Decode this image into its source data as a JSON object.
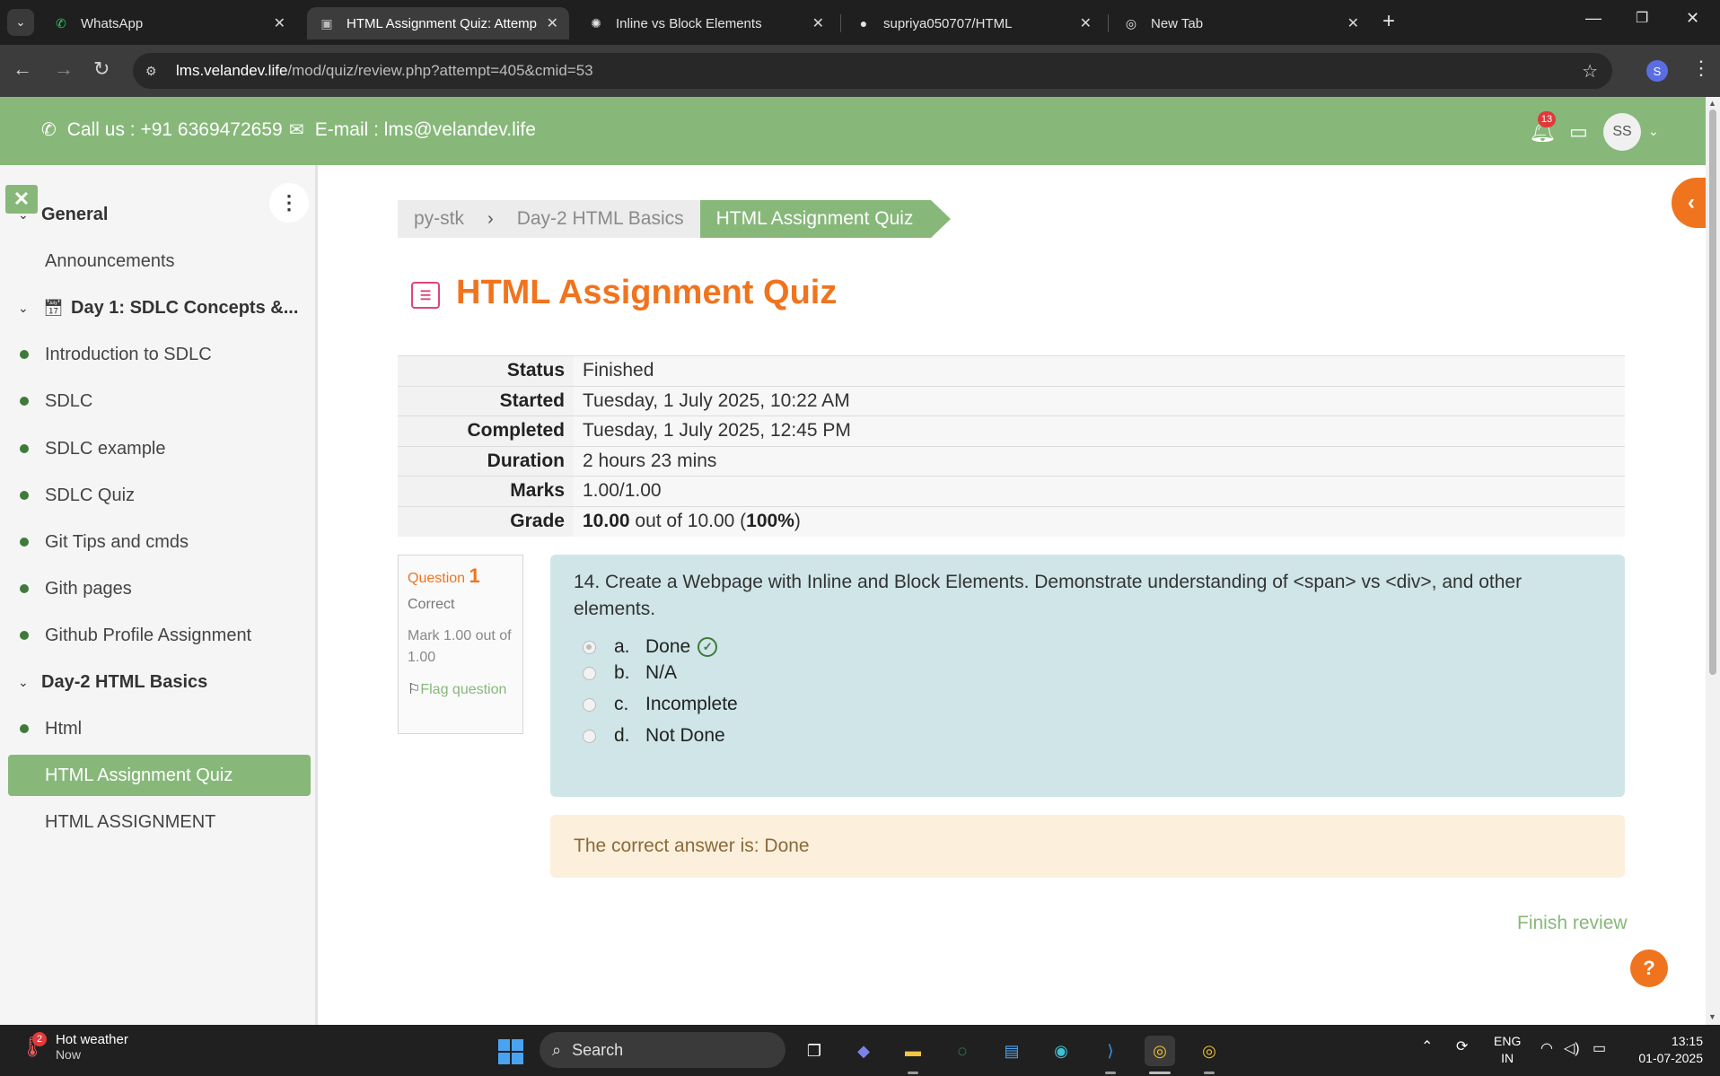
{
  "browser": {
    "tabs": [
      {
        "title": "WhatsApp",
        "icon": "whatsapp-icon",
        "active": false
      },
      {
        "title": "HTML Assignment Quiz: Attemp",
        "icon": "moodle-icon",
        "active": true
      },
      {
        "title": "Inline vs Block Elements",
        "icon": "openai-icon",
        "active": false
      },
      {
        "title": "supriya050707/HTML",
        "icon": "github-icon",
        "active": false
      },
      {
        "title": "New Tab",
        "icon": "chrome-icon",
        "active": false
      }
    ],
    "url_host": "lms.velandev.life",
    "url_path": "/mod/quiz/review.php?attempt=405&cmid=53",
    "profile_initial": "S"
  },
  "header": {
    "call": "Call us : +91 6369472659",
    "email": "E-mail : lms@velandev.life",
    "notifications": "13",
    "avatar": "SS"
  },
  "drawer": {
    "items": [
      {
        "label": "General",
        "type": "section"
      },
      {
        "label": "Announcements",
        "type": "plain"
      },
      {
        "label": "Day 1: SDLC Concepts &...",
        "type": "section-cal"
      },
      {
        "label": "Introduction to SDLC",
        "type": "bullet"
      },
      {
        "label": "SDLC",
        "type": "bullet"
      },
      {
        "label": "SDLC example",
        "type": "bullet"
      },
      {
        "label": "SDLC Quiz",
        "type": "bullet"
      },
      {
        "label": "Git Tips and cmds",
        "type": "bullet"
      },
      {
        "label": "Gith pages",
        "type": "bullet"
      },
      {
        "label": "Github Profile Assignment",
        "type": "bullet"
      },
      {
        "label": "Day-2 HTML Basics",
        "type": "section"
      },
      {
        "label": "Html",
        "type": "bullet"
      },
      {
        "label": "HTML Assignment Quiz",
        "type": "active"
      },
      {
        "label": "HTML ASSIGNMENT",
        "type": "plain"
      }
    ]
  },
  "breadcrumb": [
    "py-stk",
    "Day-2 HTML Basics",
    "HTML Assignment Quiz"
  ],
  "page_title": "HTML Assignment Quiz",
  "summary": {
    "status_label": "Status",
    "status": "Finished",
    "started_label": "Started",
    "started": "Tuesday, 1 July 2025, 10:22 AM",
    "completed_label": "Completed",
    "completed": "Tuesday, 1 July 2025, 12:45 PM",
    "duration_label": "Duration",
    "duration": "2 hours 23 mins",
    "marks_label": "Marks",
    "marks": "1.00/1.00",
    "grade_label": "Grade",
    "grade_value": "10.00",
    "grade_mid": " out of 10.00 (",
    "grade_pct": "100%",
    "grade_end": ")"
  },
  "question": {
    "label": "Question",
    "number": "1",
    "state": "Correct",
    "grade": "Mark 1.00 out of 1.00",
    "flag": "Flag question",
    "text": "14. Create a Webpage with Inline and Block Elements. Demonstrate understanding of <span> vs <div>, and other elements.",
    "answers": [
      {
        "letter": "a.",
        "text": "Done",
        "selected": true,
        "correct": true
      },
      {
        "letter": "b.",
        "text": "N/A",
        "selected": false,
        "correct": false
      },
      {
        "letter": "c.",
        "text": "Incomplete",
        "selected": false,
        "correct": false
      },
      {
        "letter": "d.",
        "text": "Not Done",
        "selected": false,
        "correct": false
      }
    ],
    "feedback": "The correct answer is: Done"
  },
  "finish_review": "Finish review",
  "help": "?",
  "taskbar": {
    "weather_title": "Hot weather",
    "weather_sub": "Now",
    "weather_badge": "2",
    "search": "Search",
    "lang1": "ENG",
    "lang2": "IN",
    "time": "13:15",
    "date": "01-07-2025"
  },
  "colors": {
    "brand_green": "#87b87a",
    "accent_orange": "#f0741e",
    "question_bg": "#cfe5e8",
    "feedback_bg": "#fcefdc"
  }
}
